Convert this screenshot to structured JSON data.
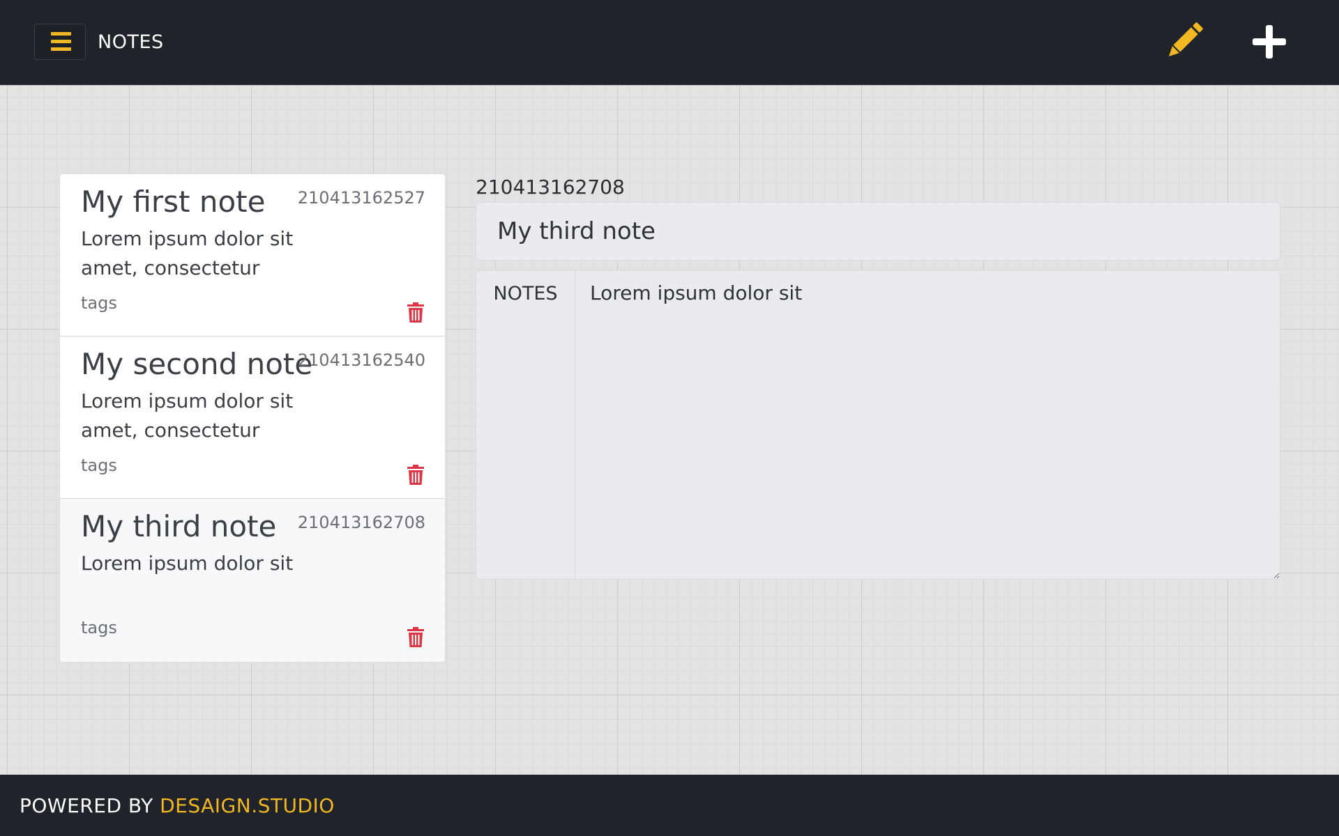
{
  "header": {
    "title": "NOTES",
    "menu_icon": "hamburger-icon",
    "edit_icon": "pencil-icon",
    "add_icon": "plus-icon"
  },
  "notes": [
    {
      "title": "My first note",
      "id": "210413162527",
      "preview": "Lorem ipsum dolor sit amet, consectetur",
      "tags": "tags",
      "delete_icon": "trash-icon",
      "active": false
    },
    {
      "title": "My second note",
      "id": "210413162540",
      "preview": "Lorem ipsum dolor sit amet, consectetur",
      "tags": "tags",
      "delete_icon": "trash-icon",
      "active": false
    },
    {
      "title": "My third note",
      "id": "210413162708",
      "preview": "Lorem ipsum dolor sit",
      "tags": "tags",
      "delete_icon": "trash-icon",
      "active": true
    }
  ],
  "editor": {
    "id": "210413162708",
    "title_value": "My third note",
    "notes_label": "NOTES",
    "notes_value": "Lorem ipsum dolor sit"
  },
  "footer": {
    "prefix": "POWERED BY ",
    "link_text": "DESAIGN.STUDIO"
  },
  "colors": {
    "bar_background": "#20242a",
    "accent": "#f2b823",
    "delete": "#dc3545",
    "canvas": "#e3e3e3"
  }
}
